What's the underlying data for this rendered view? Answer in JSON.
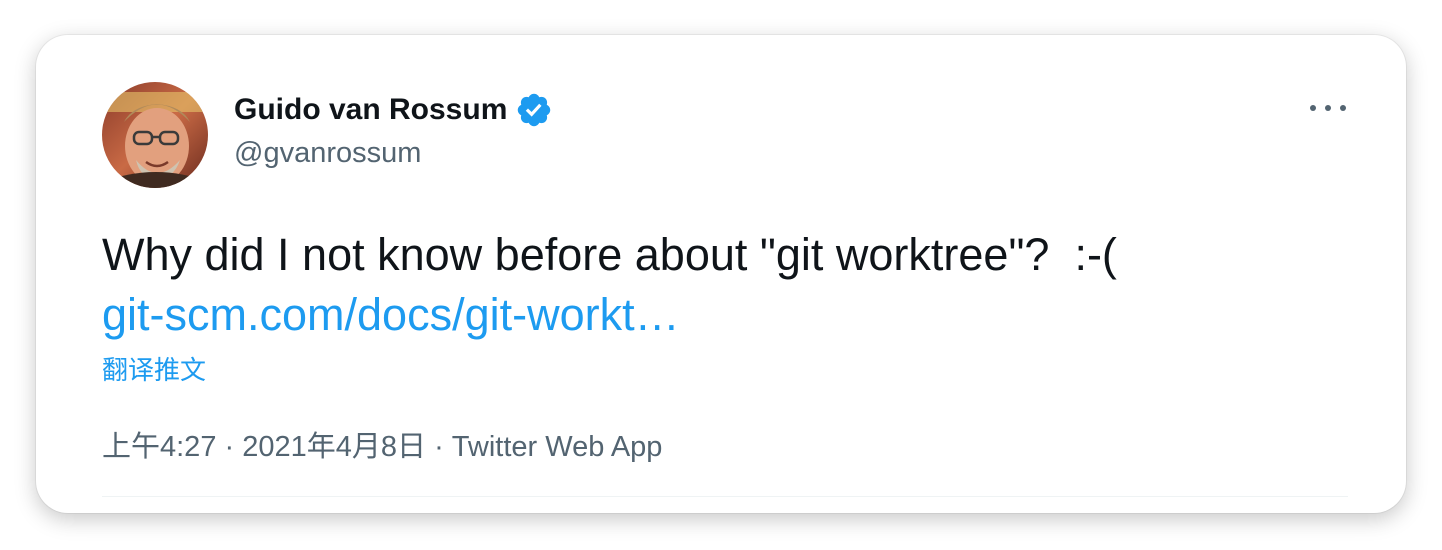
{
  "author": {
    "display_name": "Guido van Rossum",
    "handle": "@gvanrossum",
    "verified": true
  },
  "tweet": {
    "text": "Why did I not know before about \"git worktree\"?  :-(",
    "link": "git-scm.com/docs/git-workt…",
    "translate_label": "翻译推文"
  },
  "meta": {
    "time": "上午4:27",
    "separator": " · ",
    "date": "2021年4月8日",
    "app": "Twitter Web App"
  },
  "colors": {
    "text": "#0f1419",
    "secondary": "#536471",
    "accent": "#1d9bf0"
  },
  "icons": {
    "verified": "verified-badge-icon",
    "more": "more-options-icon"
  }
}
